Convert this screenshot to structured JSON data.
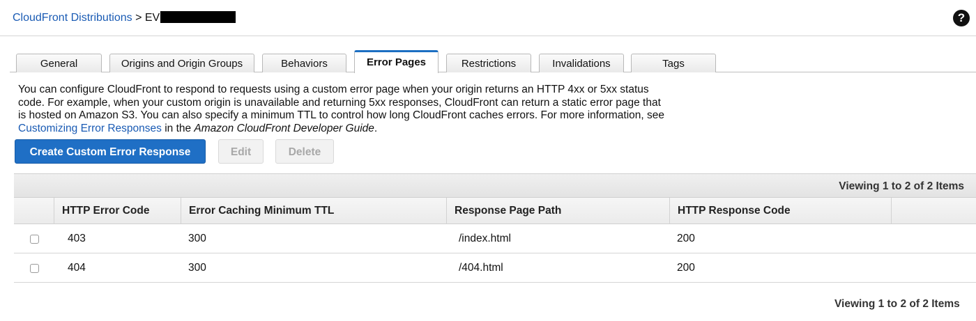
{
  "header": {
    "breadcrumb_link": "CloudFront Distributions",
    "breadcrumb_separator": ">",
    "breadcrumb_current": "EV",
    "help_icon": "help-circle-icon",
    "help_glyph": "?"
  },
  "tabs": [
    {
      "label": "General",
      "active": false
    },
    {
      "label": "Origins and Origin Groups",
      "active": false
    },
    {
      "label": "Behaviors",
      "active": false
    },
    {
      "label": "Error Pages",
      "active": true
    },
    {
      "label": "Restrictions",
      "active": false
    },
    {
      "label": "Invalidations",
      "active": false
    },
    {
      "label": "Tags",
      "active": false
    }
  ],
  "description": {
    "text_before": "You can configure CloudFront to respond to requests using a custom error page when your origin returns an HTTP 4xx or 5xx status code. For example, when your custom origin is unavailable and returning 5xx responses, CloudFront can return a static error page that is hosted on Amazon S3. You can also specify a minimum TTL to control how long CloudFront caches errors. For more information, see ",
    "link_text": "Customizing Error Responses",
    "text_middle": " in the ",
    "guide_text": "Amazon CloudFront Developer Guide",
    "text_after": "."
  },
  "toolbar": {
    "create_label": "Create Custom Error Response",
    "edit_label": "Edit",
    "delete_label": "Delete"
  },
  "grid": {
    "viewing_top": "Viewing 1 to 2 of 2 Items",
    "viewing_bottom": "Viewing 1 to 2 of 2 Items",
    "columns": [
      "HTTP Error Code",
      "Error Caching Minimum TTL",
      "Response Page Path",
      "HTTP Response Code"
    ],
    "rows": [
      {
        "checked": false,
        "error_code": "403",
        "ttl": "300",
        "path": "/index.html",
        "response_code": "200"
      },
      {
        "checked": false,
        "error_code": "404",
        "ttl": "300",
        "path": "/404.html",
        "response_code": "200"
      }
    ]
  },
  "colors": {
    "link": "#1a5bb4",
    "primary_button": "#1f6fc5",
    "active_tab_accent": "#1c6fc2"
  }
}
